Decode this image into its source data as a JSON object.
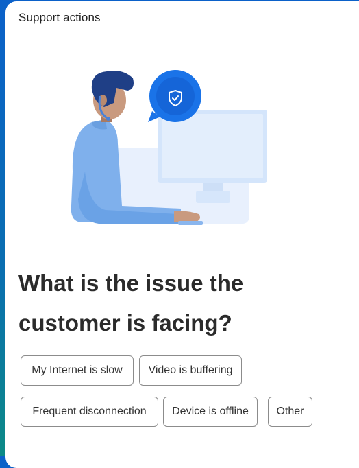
{
  "header": {
    "title": "Support actions"
  },
  "illustration": {
    "icon": "shield-check-icon",
    "accent": "#1a73e8"
  },
  "question": {
    "line1": "What is the issue the",
    "line2": "customer is facing?"
  },
  "options": [
    {
      "label": "My Internet is slow"
    },
    {
      "label": "Video is buffering"
    },
    {
      "label": "Frequent disconnection"
    },
    {
      "label": "Device is offline"
    },
    {
      "label": "Other"
    }
  ]
}
